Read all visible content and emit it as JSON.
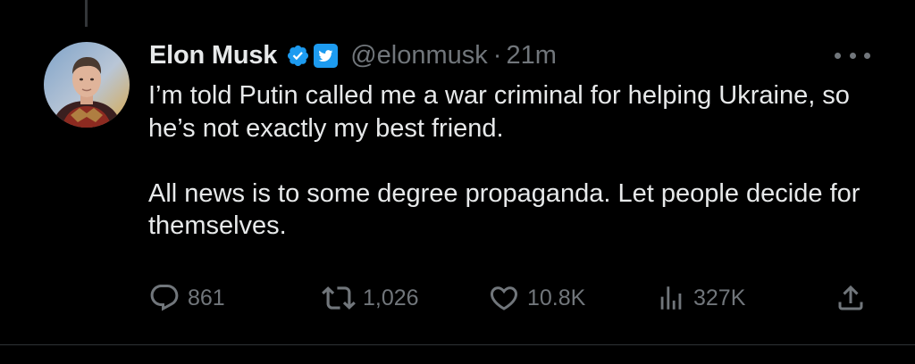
{
  "tweet": {
    "author_name": "Elon Musk",
    "handle": "@elonmusk",
    "separator": "·",
    "timestamp": "21m",
    "paragraphs": [
      "I’m told Putin called me a war criminal for helping Ukraine, so he’s not exactly my best friend.",
      "All news is to some degree propaganda. Let people decide for themselves."
    ],
    "badges": [
      "verified-check-icon",
      "twitter-bird-icon"
    ],
    "colors": {
      "background": "#000000",
      "primary_text": "#e7e9ea",
      "secondary_text": "#71767b",
      "verified_blue": "#1d9bf0"
    }
  },
  "actions": {
    "replies": "861",
    "reposts": "1,026",
    "likes": "10.8K",
    "views": "327K"
  },
  "icons": [
    "reply-icon",
    "repost-icon",
    "like-icon",
    "views-icon",
    "share-icon",
    "more-icon"
  ]
}
